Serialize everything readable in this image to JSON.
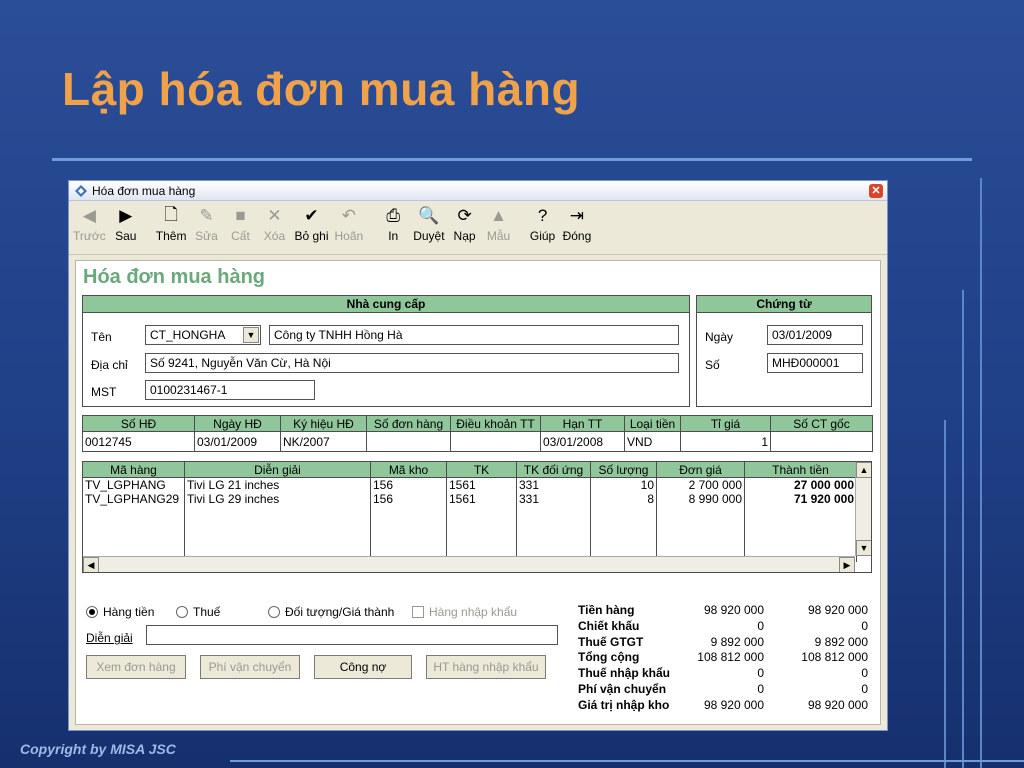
{
  "slide": {
    "title": "Lập hóa đơn mua hàng",
    "copyright": "Copyright by MISA JSC"
  },
  "window": {
    "title": "Hóa đơn mua hàng",
    "close_label": "✕"
  },
  "toolbar": [
    {
      "label": "Trước",
      "icon": "◀",
      "enabled": false
    },
    {
      "label": "Sau",
      "icon": "▶",
      "enabled": true
    },
    {
      "label": "Thêm",
      "icon": "🗋",
      "enabled": true
    },
    {
      "label": "Sửa",
      "icon": "✎",
      "enabled": false
    },
    {
      "label": "Cất",
      "icon": "■",
      "enabled": false
    },
    {
      "label": "Xóa",
      "icon": "✕",
      "enabled": false
    },
    {
      "label": "Bỏ ghi",
      "icon": "✔",
      "enabled": true
    },
    {
      "label": "Hoãn",
      "icon": "↶",
      "enabled": false
    },
    {
      "label": "In",
      "icon": "⎙",
      "enabled": true
    },
    {
      "label": "Duyệt",
      "icon": "🔍",
      "enabled": true
    },
    {
      "label": "Nạp",
      "icon": "⟳",
      "enabled": true
    },
    {
      "label": "Mẫu",
      "icon": "▲",
      "enabled": false
    },
    {
      "label": "Giúp",
      "icon": "?",
      "enabled": true
    },
    {
      "label": "Đóng",
      "icon": "⇥",
      "enabled": true
    }
  ],
  "form": {
    "title": "Hóa đơn mua hàng"
  },
  "supplier": {
    "header": "Nhà cung cấp",
    "name_label": "Tên",
    "code": "CT_HONGHA",
    "company": "Công ty TNHH Hồng Hà",
    "address_label": "Địa chỉ",
    "address": "Số 9241, Nguyễn Văn Cừ, Hà Nội",
    "tax_label": "MST",
    "tax": "0100231467-1"
  },
  "voucher": {
    "header": "Chứng từ",
    "date_label": "Ngày",
    "date": "03/01/2009",
    "number_label": "Số",
    "number": "MHĐ000001"
  },
  "invoice_table": {
    "headers": [
      "Số HĐ",
      "Ngày HĐ",
      "Ký hiệu HĐ",
      "Số đơn hàng",
      "Điều khoản TT",
      "Hạn TT",
      "Loại tiền",
      "Tỉ giá",
      "Số CT gốc"
    ],
    "row": [
      "0012745",
      "03/01/2009",
      "NK/2007",
      "",
      "",
      "03/01/2008",
      "VND",
      "1",
      ""
    ]
  },
  "items_table": {
    "headers": [
      "Mã hàng",
      "Diễn giải",
      "Mã kho",
      "TK",
      "TK đối ứng",
      "Số lượng",
      "Đơn giá",
      "Thành tiền"
    ],
    "rows": [
      [
        "TV_LGPHANG",
        "Tivi LG 21 inches",
        "156",
        "1561",
        "331",
        "10",
        "2 700 000",
        "27 000 000"
      ],
      [
        "TV_LGPHANG29",
        "Tivi LG 29 inches",
        "156",
        "1561",
        "331",
        "8",
        "8 990 000",
        "71 920 000"
      ]
    ]
  },
  "options": {
    "radios": [
      {
        "label": "Hàng tiền",
        "checked": true
      },
      {
        "label": "Thuế",
        "checked": false
      },
      {
        "label": "Đối tượng/Giá thành",
        "checked": false
      }
    ],
    "import_check": "Hàng nhập khẩu",
    "description_label": "Diễn giải",
    "description": ""
  },
  "buttons": [
    {
      "label": "Xem đơn hàng",
      "enabled": false
    },
    {
      "label": "Phí vận chuyển",
      "enabled": false
    },
    {
      "label": "Công nợ",
      "enabled": true
    },
    {
      "label": "HT hàng nhập khẩu",
      "enabled": false
    }
  ],
  "summary": [
    {
      "label": "Tiền hàng",
      "v1": "98 920 000",
      "v2": "98 920 000"
    },
    {
      "label": "Chiết khấu",
      "v1": "0",
      "v2": "0"
    },
    {
      "label": "Thuế GTGT",
      "v1": "9 892 000",
      "v2": "9 892 000"
    },
    {
      "label": "Tổng cộng",
      "v1": "108 812 000",
      "v2": "108 812 000"
    },
    {
      "label": "Thuế nhập khẩu",
      "v1": "0",
      "v2": "0"
    },
    {
      "label": "Phí vận chuyển",
      "v1": "0",
      "v2": "0"
    },
    {
      "label": "Giá trị nhập kho",
      "v1": "98 920 000",
      "v2": "98 920 000"
    }
  ]
}
